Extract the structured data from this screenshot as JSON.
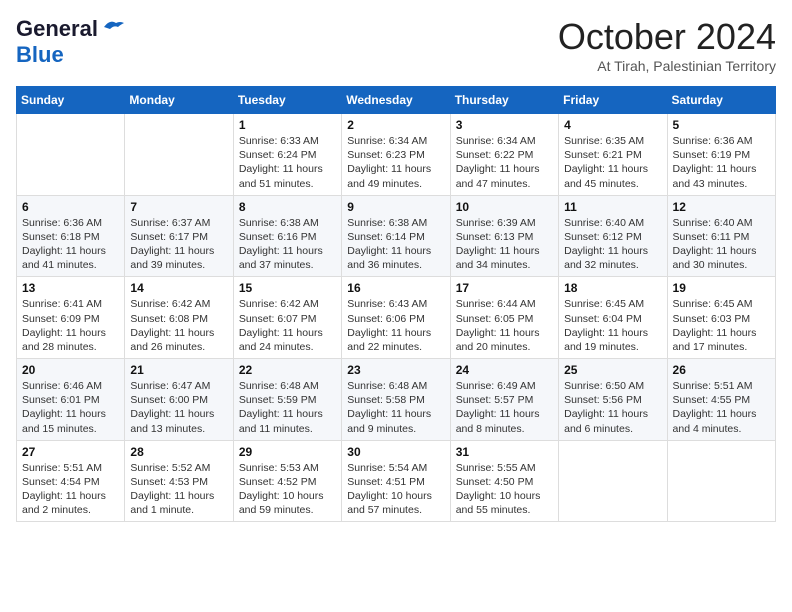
{
  "header": {
    "logo_line1": "General",
    "logo_line2": "Blue",
    "month": "October 2024",
    "location": "At Tirah, Palestinian Territory"
  },
  "days_of_week": [
    "Sunday",
    "Monday",
    "Tuesday",
    "Wednesday",
    "Thursday",
    "Friday",
    "Saturday"
  ],
  "weeks": [
    [
      {
        "day": "",
        "info": ""
      },
      {
        "day": "",
        "info": ""
      },
      {
        "day": "1",
        "info": "Sunrise: 6:33 AM\nSunset: 6:24 PM\nDaylight: 11 hours and 51 minutes."
      },
      {
        "day": "2",
        "info": "Sunrise: 6:34 AM\nSunset: 6:23 PM\nDaylight: 11 hours and 49 minutes."
      },
      {
        "day": "3",
        "info": "Sunrise: 6:34 AM\nSunset: 6:22 PM\nDaylight: 11 hours and 47 minutes."
      },
      {
        "day": "4",
        "info": "Sunrise: 6:35 AM\nSunset: 6:21 PM\nDaylight: 11 hours and 45 minutes."
      },
      {
        "day": "5",
        "info": "Sunrise: 6:36 AM\nSunset: 6:19 PM\nDaylight: 11 hours and 43 minutes."
      }
    ],
    [
      {
        "day": "6",
        "info": "Sunrise: 6:36 AM\nSunset: 6:18 PM\nDaylight: 11 hours and 41 minutes."
      },
      {
        "day": "7",
        "info": "Sunrise: 6:37 AM\nSunset: 6:17 PM\nDaylight: 11 hours and 39 minutes."
      },
      {
        "day": "8",
        "info": "Sunrise: 6:38 AM\nSunset: 6:16 PM\nDaylight: 11 hours and 37 minutes."
      },
      {
        "day": "9",
        "info": "Sunrise: 6:38 AM\nSunset: 6:14 PM\nDaylight: 11 hours and 36 minutes."
      },
      {
        "day": "10",
        "info": "Sunrise: 6:39 AM\nSunset: 6:13 PM\nDaylight: 11 hours and 34 minutes."
      },
      {
        "day": "11",
        "info": "Sunrise: 6:40 AM\nSunset: 6:12 PM\nDaylight: 11 hours and 32 minutes."
      },
      {
        "day": "12",
        "info": "Sunrise: 6:40 AM\nSunset: 6:11 PM\nDaylight: 11 hours and 30 minutes."
      }
    ],
    [
      {
        "day": "13",
        "info": "Sunrise: 6:41 AM\nSunset: 6:09 PM\nDaylight: 11 hours and 28 minutes."
      },
      {
        "day": "14",
        "info": "Sunrise: 6:42 AM\nSunset: 6:08 PM\nDaylight: 11 hours and 26 minutes."
      },
      {
        "day": "15",
        "info": "Sunrise: 6:42 AM\nSunset: 6:07 PM\nDaylight: 11 hours and 24 minutes."
      },
      {
        "day": "16",
        "info": "Sunrise: 6:43 AM\nSunset: 6:06 PM\nDaylight: 11 hours and 22 minutes."
      },
      {
        "day": "17",
        "info": "Sunrise: 6:44 AM\nSunset: 6:05 PM\nDaylight: 11 hours and 20 minutes."
      },
      {
        "day": "18",
        "info": "Sunrise: 6:45 AM\nSunset: 6:04 PM\nDaylight: 11 hours and 19 minutes."
      },
      {
        "day": "19",
        "info": "Sunrise: 6:45 AM\nSunset: 6:03 PM\nDaylight: 11 hours and 17 minutes."
      }
    ],
    [
      {
        "day": "20",
        "info": "Sunrise: 6:46 AM\nSunset: 6:01 PM\nDaylight: 11 hours and 15 minutes."
      },
      {
        "day": "21",
        "info": "Sunrise: 6:47 AM\nSunset: 6:00 PM\nDaylight: 11 hours and 13 minutes."
      },
      {
        "day": "22",
        "info": "Sunrise: 6:48 AM\nSunset: 5:59 PM\nDaylight: 11 hours and 11 minutes."
      },
      {
        "day": "23",
        "info": "Sunrise: 6:48 AM\nSunset: 5:58 PM\nDaylight: 11 hours and 9 minutes."
      },
      {
        "day": "24",
        "info": "Sunrise: 6:49 AM\nSunset: 5:57 PM\nDaylight: 11 hours and 8 minutes."
      },
      {
        "day": "25",
        "info": "Sunrise: 6:50 AM\nSunset: 5:56 PM\nDaylight: 11 hours and 6 minutes."
      },
      {
        "day": "26",
        "info": "Sunrise: 5:51 AM\nSunset: 4:55 PM\nDaylight: 11 hours and 4 minutes."
      }
    ],
    [
      {
        "day": "27",
        "info": "Sunrise: 5:51 AM\nSunset: 4:54 PM\nDaylight: 11 hours and 2 minutes."
      },
      {
        "day": "28",
        "info": "Sunrise: 5:52 AM\nSunset: 4:53 PM\nDaylight: 11 hours and 1 minute."
      },
      {
        "day": "29",
        "info": "Sunrise: 5:53 AM\nSunset: 4:52 PM\nDaylight: 10 hours and 59 minutes."
      },
      {
        "day": "30",
        "info": "Sunrise: 5:54 AM\nSunset: 4:51 PM\nDaylight: 10 hours and 57 minutes."
      },
      {
        "day": "31",
        "info": "Sunrise: 5:55 AM\nSunset: 4:50 PM\nDaylight: 10 hours and 55 minutes."
      },
      {
        "day": "",
        "info": ""
      },
      {
        "day": "",
        "info": ""
      }
    ]
  ]
}
